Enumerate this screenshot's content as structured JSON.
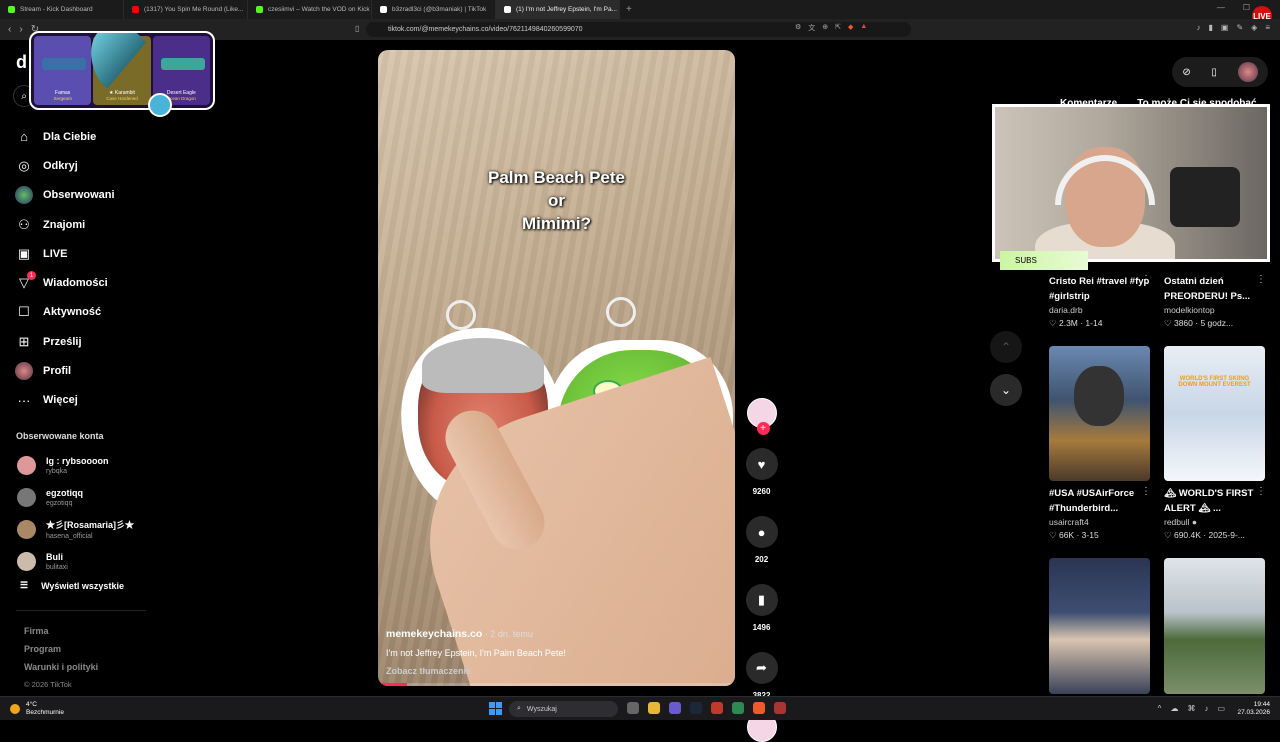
{
  "browser": {
    "tabs": [
      {
        "label": "Stream - Kick Dashboard",
        "color": "#53fc18"
      },
      {
        "label": "(1317) You Spin Me Round (Like...",
        "color": "#ff0000"
      },
      {
        "label": "czesiimvi – Watch the VOD on Kick",
        "color": "#53fc18"
      },
      {
        "label": "b3zradl3ci (@b3maniak) | TikTok",
        "color": "#ffffff"
      },
      {
        "label": "(1) I'm not Jeffrey Epstein, I'm Pa...",
        "color": "#ffffff"
      }
    ],
    "url": "tiktok.com/@memekeychains.co/video/7621149840260599070"
  },
  "overlay": {
    "skins": [
      {
        "name": "Famas",
        "sub": "Sergeant",
        "color": "#5a4fb0"
      },
      {
        "name": "★ Karambit",
        "sub": "Case Hardened",
        "color": "#7a6b28"
      },
      {
        "name": "Desert Eagle",
        "sub": "Ocean Dragon",
        "color": "#4b2d8a"
      }
    ]
  },
  "sidebar": {
    "logo": "d",
    "items": [
      {
        "label": "Dla Ciebie",
        "icon": "home-icon",
        "glyph": "⌂"
      },
      {
        "label": "Odkryj",
        "icon": "compass-icon",
        "glyph": "◎"
      },
      {
        "label": "Obserwowani",
        "icon": "following-icon",
        "glyph": ""
      },
      {
        "label": "Znajomi",
        "icon": "friends-icon",
        "glyph": "👥"
      },
      {
        "label": "LIVE",
        "icon": "live-icon",
        "glyph": "▣"
      },
      {
        "label": "Wiadomości",
        "icon": "messages-icon",
        "glyph": "▽",
        "badge": "1"
      },
      {
        "label": "Aktywność",
        "icon": "activity-icon",
        "glyph": "☐"
      },
      {
        "label": "Prześlij",
        "icon": "upload-icon",
        "glyph": "⊞"
      },
      {
        "label": "Profil",
        "icon": "profile-icon",
        "glyph": ""
      },
      {
        "label": "Więcej",
        "icon": "more-icon",
        "glyph": "···"
      }
    ],
    "following_title": "Obserwowane konta",
    "following": [
      {
        "name": "Ig : rybsoooon",
        "user": "rybqka",
        "color": "#d99"
      },
      {
        "name": "egzotiqq",
        "user": "egzotiqq",
        "color": "#777"
      },
      {
        "name": "★彡[Rosamaria]彡★",
        "user": "hasena_official",
        "color": "#a86"
      },
      {
        "name": "Buli",
        "user": "bulitaxi",
        "color": "#cba"
      }
    ],
    "show_all": "Wyświetl wszystkie",
    "footer": [
      "Firma",
      "Program",
      "Warunki i polityki"
    ],
    "copyright": "© 2026 TikTok"
  },
  "video": {
    "caption_lines": [
      "Palm Beach Pete",
      "or",
      "Mimimi?"
    ],
    "author": "memekeychains.co",
    "ago": " · 2 dn. temu",
    "description": "I'm not Jeffrey Epstein, I'm Palm Beach Pete!",
    "translate": "Zobacz tłumaczenie",
    "progress": 0.08
  },
  "actions": {
    "likes": "9260",
    "comments": "202",
    "saves": "1496",
    "shares": "3822"
  },
  "right": {
    "tabs": [
      "Komentarze",
      "To może Ci się spodobać"
    ],
    "subs_label": "SUBS",
    "cards": [
      {
        "title": "Cristo Rei #travel #fyp #girlstrip",
        "user": "daria.drb",
        "stats": "♡ 2.3M · 1-14"
      },
      {
        "title": "Ostatni dzień PREORDERU! Ps...",
        "user": "modelkiontop",
        "stats": "♡ 3860 · 5 godz..."
      },
      {
        "title": "#USA #USAirForce #Thunderbird...",
        "user": "usaircraft4",
        "stats": "♡ 66K · 3-15"
      },
      {
        "title": "🏔 WORLD'S FIRST ALERT 🏔 ...",
        "user": "redbull ●",
        "stats": "♡ 690.4K · 2025-9-..."
      }
    ],
    "thumb_text": "WORLD'S FIRST SKIING DOWN MOUNT EVEREST"
  },
  "taskbar": {
    "temp": "4°C",
    "weather": "Bezchmurnie",
    "search": "Wyszukaj",
    "time": "19:44",
    "date": "27.03.2026"
  }
}
